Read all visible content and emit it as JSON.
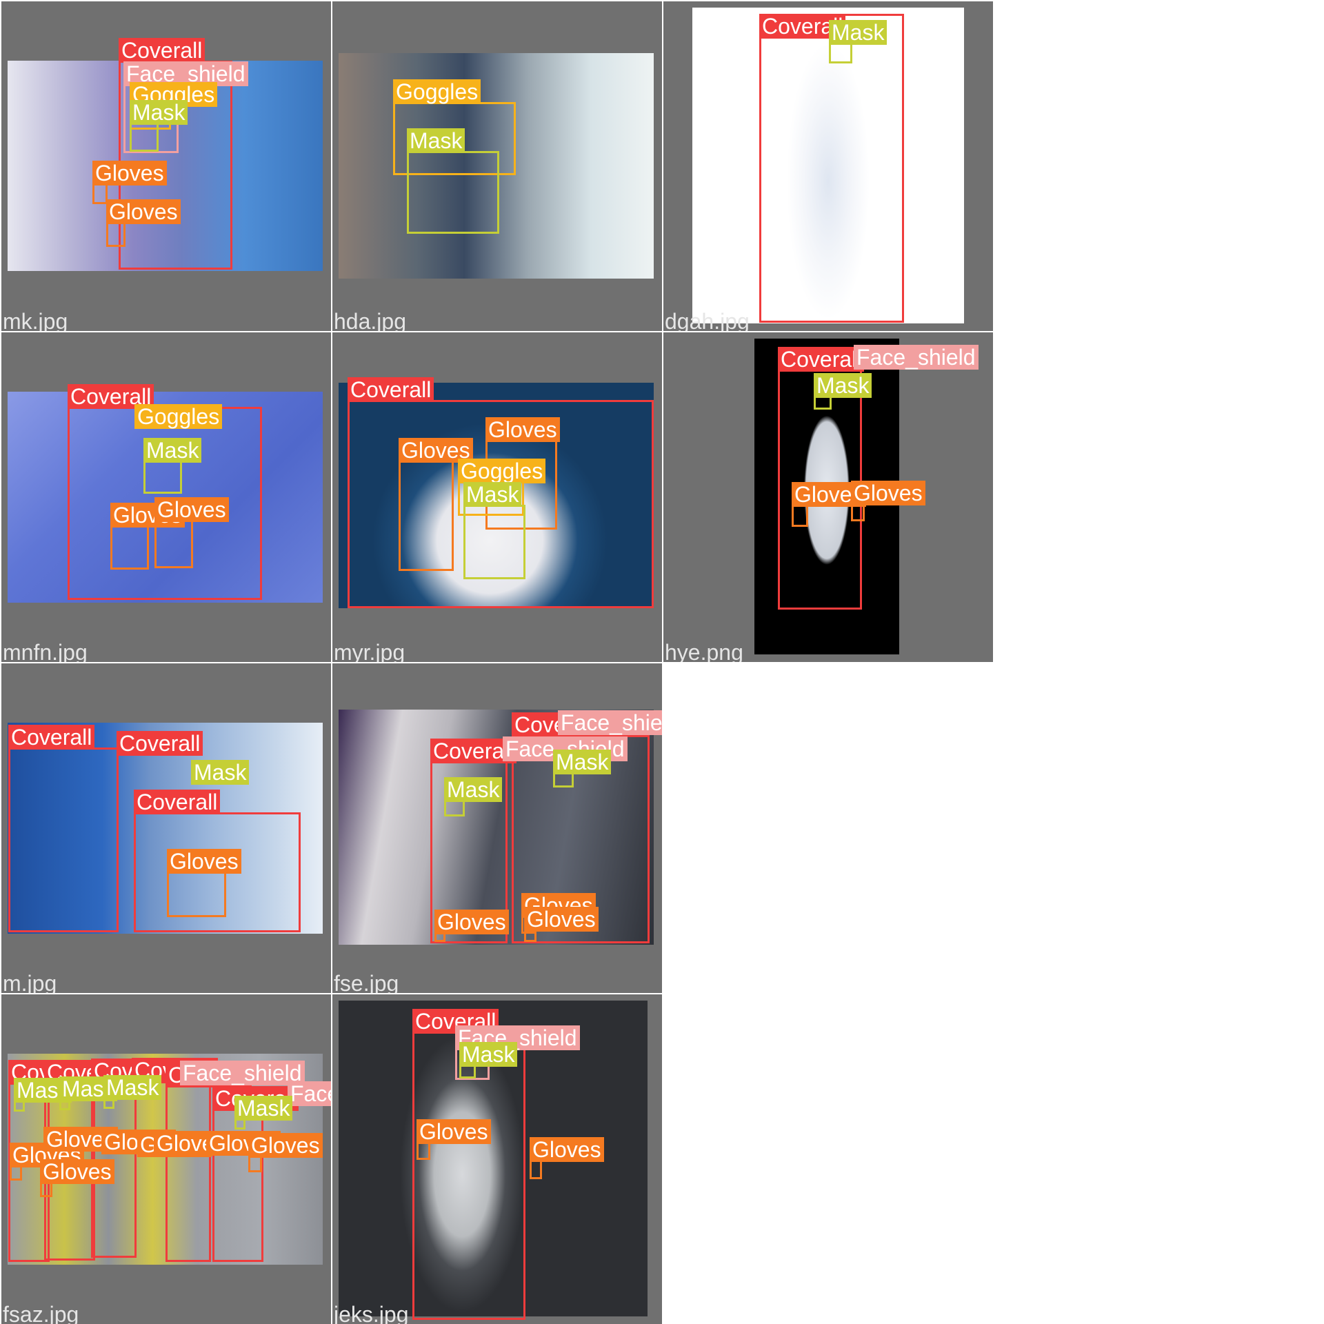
{
  "mosaic": {
    "cells": [
      {
        "file": "mk.jpg"
      },
      {
        "file": "hda.jpg"
      },
      {
        "file": "dgah.jpg"
      },
      {
        "file": "mnfn.jpg"
      },
      {
        "file": "myr.jpg"
      },
      {
        "file": "hye.png"
      },
      {
        "file": "m.jpg"
      },
      {
        "file": "fse.jpg"
      },
      {
        "file": "fsaz.jpg"
      },
      {
        "file": "jeks.jpg"
      }
    ]
  },
  "labels": {
    "coverall": "Coverall",
    "face_shield": "Face_shield",
    "goggles": "Goggles",
    "mask": "Mask",
    "gloves": "Gloves"
  },
  "colors": {
    "background": "#707070",
    "coverall": "#f03c3c",
    "face_shield": "#f2a0a0",
    "goggles": "#f7b21a",
    "mask": "#c5cf36",
    "gloves": "#f57a20"
  }
}
